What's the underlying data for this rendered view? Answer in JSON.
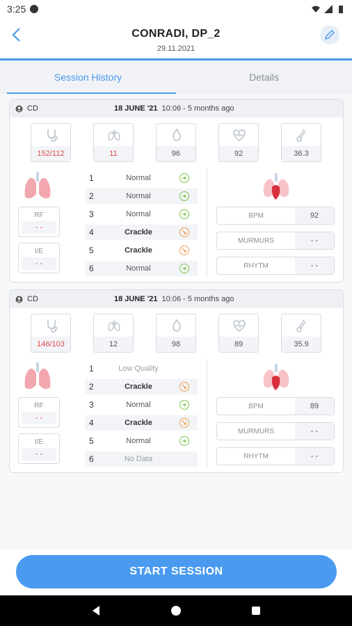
{
  "status_bar": {
    "time": "3:25"
  },
  "header": {
    "title": "CONRADI, DP_2",
    "date": "29.11.2021"
  },
  "tabs": [
    {
      "label": "Session History",
      "active": true
    },
    {
      "label": "Details",
      "active": false
    }
  ],
  "sessions": [
    {
      "user": "CD",
      "date": "18 JUNE '21",
      "time": "10:06 - 5 months ago",
      "vitals": {
        "blood_pressure": {
          "value": "152/112",
          "alert": true
        },
        "respiration": {
          "value": "11",
          "alert": true
        },
        "oxygen": {
          "value": "96",
          "alert": false
        },
        "heart_rate": {
          "value": "92",
          "alert": false
        },
        "temperature": {
          "value": "36.3",
          "alert": false
        }
      },
      "rf": {
        "label": "RF",
        "value": "- -"
      },
      "ie": {
        "label": "I/E",
        "value": "- -"
      },
      "sites": [
        {
          "num": "1",
          "status": "Normal",
          "kind": "normal"
        },
        {
          "num": "2",
          "status": "Normal",
          "kind": "normal"
        },
        {
          "num": "3",
          "status": "Normal",
          "kind": "normal"
        },
        {
          "num": "4",
          "status": "Crackle",
          "kind": "crackle"
        },
        {
          "num": "5",
          "status": "Crackle",
          "kind": "crackle"
        },
        {
          "num": "6",
          "status": "Normal",
          "kind": "normal"
        }
      ],
      "bpm": {
        "label": "BPM",
        "value": "92"
      },
      "murmurs": {
        "label": "MURMURS",
        "value": "- -"
      },
      "rhythm": {
        "label": "RHYTM",
        "value": "- -"
      }
    },
    {
      "user": "CD",
      "date": "18 JUNE '21",
      "time": "10:06 - 5 months ago",
      "vitals": {
        "blood_pressure": {
          "value": "146/103",
          "alert": true
        },
        "respiration": {
          "value": "12",
          "alert": false
        },
        "oxygen": {
          "value": "98",
          "alert": false
        },
        "heart_rate": {
          "value": "89",
          "alert": false
        },
        "temperature": {
          "value": "35.9",
          "alert": false
        }
      },
      "rf": {
        "label": "RF",
        "value": "- -"
      },
      "ie": {
        "label": "I/E",
        "value": "- -"
      },
      "sites": [
        {
          "num": "1",
          "status": "Low Quality",
          "kind": "low"
        },
        {
          "num": "2",
          "status": "Crackle",
          "kind": "crackle"
        },
        {
          "num": "3",
          "status": "Normal",
          "kind": "normal"
        },
        {
          "num": "4",
          "status": "Crackle",
          "kind": "crackle"
        },
        {
          "num": "5",
          "status": "Normal",
          "kind": "normal"
        },
        {
          "num": "6",
          "status": "No Data",
          "kind": "nodata"
        }
      ],
      "bpm": {
        "label": "BPM",
        "value": "89"
      },
      "murmurs": {
        "label": "MURMURS",
        "value": "- -"
      },
      "rhythm": {
        "label": "RHYTM",
        "value": "- -"
      }
    }
  ],
  "cta": {
    "label": "START SESSION"
  },
  "colors": {
    "accent": "#4a9af0",
    "alert": "#e04a4a",
    "normal": "#7cc64a",
    "crackle": "#f0a050"
  }
}
